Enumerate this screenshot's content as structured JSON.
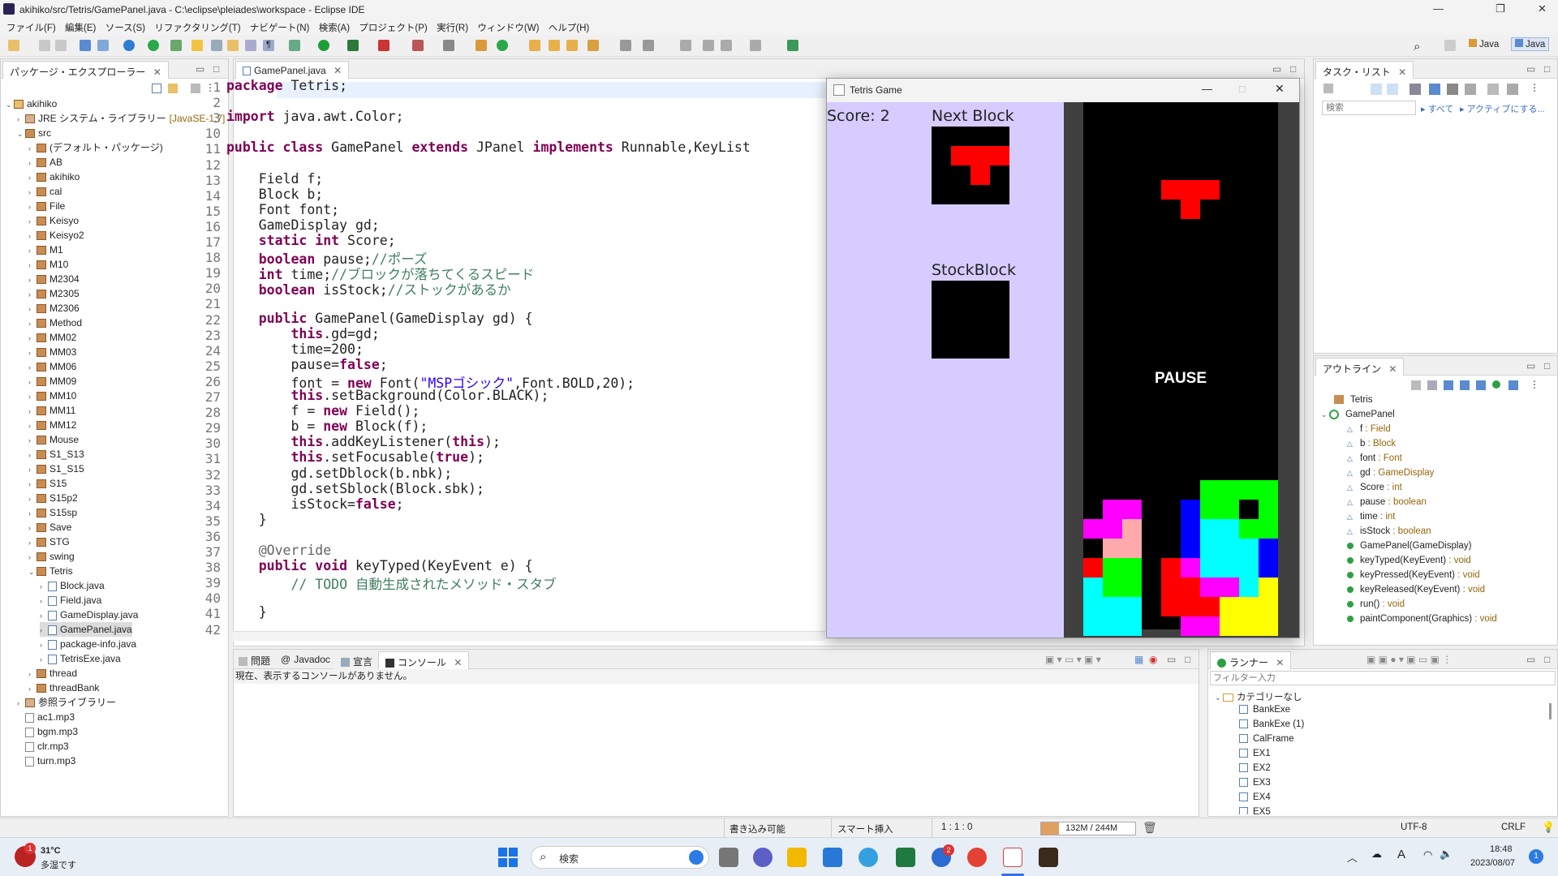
{
  "window": {
    "title": "akihiko/src/Tetris/GamePanel.java - C:\\eclipse\\pleiades\\workspace - Eclipse IDE"
  },
  "menu": [
    "ファイル(F)",
    "編集(E)",
    "ソース(S)",
    "リファクタリング(T)",
    "ナビゲート(N)",
    "検索(A)",
    "プロジェクト(P)",
    "実行(R)",
    "ウィンドウ(W)",
    "ヘルプ(H)"
  ],
  "perspectives": [
    "Java",
    "Java"
  ],
  "explorer": {
    "tab": "パッケージ・エクスプローラー",
    "items": [
      {
        "label": "akihiko",
        "level": 0,
        "kind": "project",
        "expanded": true
      },
      {
        "label": "JRE システム・ライブラリー",
        "extra": "[JavaSE-1.7]",
        "level": 1,
        "kind": "lib"
      },
      {
        "label": "src",
        "level": 1,
        "kind": "src",
        "expanded": true
      },
      {
        "label": "(デフォルト・パッケージ)",
        "level": 2,
        "kind": "pkg"
      },
      {
        "label": "AB",
        "level": 2,
        "kind": "pkg"
      },
      {
        "label": "akihiko",
        "level": 2,
        "kind": "pkg"
      },
      {
        "label": "cal",
        "level": 2,
        "kind": "pkg"
      },
      {
        "label": "File",
        "level": 2,
        "kind": "pkg"
      },
      {
        "label": "Keisyo",
        "level": 2,
        "kind": "pkg"
      },
      {
        "label": "Keisyo2",
        "level": 2,
        "kind": "pkg"
      },
      {
        "label": "M1",
        "level": 2,
        "kind": "pkg"
      },
      {
        "label": "M10",
        "level": 2,
        "kind": "pkg"
      },
      {
        "label": "M2304",
        "level": 2,
        "kind": "pkg"
      },
      {
        "label": "M2305",
        "level": 2,
        "kind": "pkg"
      },
      {
        "label": "M2306",
        "level": 2,
        "kind": "pkg"
      },
      {
        "label": "Method",
        "level": 2,
        "kind": "pkg"
      },
      {
        "label": "MM02",
        "level": 2,
        "kind": "pkg"
      },
      {
        "label": "MM03",
        "level": 2,
        "kind": "pkg"
      },
      {
        "label": "MM06",
        "level": 2,
        "kind": "pkg"
      },
      {
        "label": "MM09",
        "level": 2,
        "kind": "pkg"
      },
      {
        "label": "MM10",
        "level": 2,
        "kind": "pkg"
      },
      {
        "label": "MM11",
        "level": 2,
        "kind": "pkg"
      },
      {
        "label": "MM12",
        "level": 2,
        "kind": "pkg"
      },
      {
        "label": "Mouse",
        "level": 2,
        "kind": "pkg"
      },
      {
        "label": "S1_S13",
        "level": 2,
        "kind": "pkg"
      },
      {
        "label": "S1_S15",
        "level": 2,
        "kind": "pkg"
      },
      {
        "label": "S15",
        "level": 2,
        "kind": "pkg"
      },
      {
        "label": "S15p2",
        "level": 2,
        "kind": "pkg"
      },
      {
        "label": "S15sp",
        "level": 2,
        "kind": "pkg"
      },
      {
        "label": "Save",
        "level": 2,
        "kind": "pkg"
      },
      {
        "label": "STG",
        "level": 2,
        "kind": "pkg"
      },
      {
        "label": "swing",
        "level": 2,
        "kind": "pkg"
      },
      {
        "label": "Tetris",
        "level": 2,
        "kind": "pkg",
        "expanded": true
      },
      {
        "label": "Block.java",
        "level": 3,
        "kind": "java"
      },
      {
        "label": "Field.java",
        "level": 3,
        "kind": "java"
      },
      {
        "label": "GameDisplay.java",
        "level": 3,
        "kind": "java"
      },
      {
        "label": "GamePanel.java",
        "level": 3,
        "kind": "java",
        "selected": true
      },
      {
        "label": "package-info.java",
        "level": 3,
        "kind": "java"
      },
      {
        "label": "TetrisExe.java",
        "level": 3,
        "kind": "java"
      },
      {
        "label": "thread",
        "level": 2,
        "kind": "pkg"
      },
      {
        "label": "threadBank",
        "level": 2,
        "kind": "pkg"
      },
      {
        "label": "参照ライブラリー",
        "level": 1,
        "kind": "lib"
      },
      {
        "label": "ac1.mp3",
        "level": 1,
        "kind": "mp3"
      },
      {
        "label": "bgm.mp3",
        "level": 1,
        "kind": "mp3"
      },
      {
        "label": "clr.mp3",
        "level": 1,
        "kind": "mp3"
      },
      {
        "label": "turn.mp3",
        "level": 1,
        "kind": "mp3"
      }
    ]
  },
  "editor": {
    "tab": "GamePanel.java",
    "lines": [
      {
        "n": "1",
        "html": "<span class='kw'>package</span> Tetris;"
      },
      {
        "n": "2",
        "html": ""
      },
      {
        "n": "3",
        "html": "<span class='kw'>import</span> java.awt.Color;"
      },
      {
        "n": "10",
        "html": ""
      },
      {
        "n": "11",
        "html": "<span class='kw'>public class</span> GamePanel <span class='kw'>extends</span> JPanel <span class='kw'>implements</span> Runnable,KeyList"
      },
      {
        "n": "12",
        "html": ""
      },
      {
        "n": "13",
        "html": "    Field f;"
      },
      {
        "n": "14",
        "html": "    Block b;"
      },
      {
        "n": "15",
        "html": "    Font font;"
      },
      {
        "n": "16",
        "html": "    GameDisplay gd;"
      },
      {
        "n": "17",
        "html": "    <span class='kw'>static int</span> Score;"
      },
      {
        "n": "18",
        "html": "    <span class='kw'>boolean</span> pause;<span class='cm'>//ポーズ</span>"
      },
      {
        "n": "19",
        "html": "    <span class='kw'>int</span> time;<span class='cm'>//ブロックが落ちてくるスピード</span>"
      },
      {
        "n": "20",
        "html": "    <span class='kw'>boolean</span> isStock;<span class='cm'>//ストックがあるか</span>"
      },
      {
        "n": "21",
        "html": ""
      },
      {
        "n": "22",
        "html": "    <span class='kw'>public</span> GamePanel(GameDisplay gd) {"
      },
      {
        "n": "23",
        "html": "        <span class='kw'>this</span>.gd=gd;"
      },
      {
        "n": "24",
        "html": "        time=200;"
      },
      {
        "n": "25",
        "html": "        pause=<span class='kw'>false</span>;"
      },
      {
        "n": "26",
        "html": "        font = <span class='kw'>new</span> Font(<span class='str'>\"MSPゴシック\"</span>,Font.BOLD,20);"
      },
      {
        "n": "27",
        "html": "        <span class='kw'>this</span>.setBackground(Color.BLACK);"
      },
      {
        "n": "28",
        "html": "        f = <span class='kw'>new</span> Field();"
      },
      {
        "n": "29",
        "html": "        b = <span class='kw'>new</span> Block(f);"
      },
      {
        "n": "30",
        "html": "        <span class='kw'>this</span>.addKeyListener(<span class='kw'>this</span>);"
      },
      {
        "n": "31",
        "html": "        <span class='kw'>this</span>.setFocusable(<span class='kw'>true</span>);"
      },
      {
        "n": "32",
        "html": "        gd.setDblock(b.nbk);"
      },
      {
        "n": "33",
        "html": "        gd.setSblock(Block.sbk);"
      },
      {
        "n": "34",
        "html": "        isStock=<span class='kw'>false</span>;"
      },
      {
        "n": "35",
        "html": "    }"
      },
      {
        "n": "36",
        "html": ""
      },
      {
        "n": "37",
        "html": "    <span class='ann'>@Override</span>"
      },
      {
        "n": "38",
        "html": "    <span class='kw'>public void</span> keyTyped(KeyEvent e) {"
      },
      {
        "n": "39",
        "html": "        <span class='cm'>// TODO 自動生成されたメソッド・スタブ</span>"
      },
      {
        "n": "40",
        "html": ""
      },
      {
        "n": "41",
        "html": "    }"
      },
      {
        "n": "42",
        "html": ""
      }
    ]
  },
  "tasklist": {
    "tab": "タスク・リスト",
    "search_placeholder": "検索",
    "all": "すべて",
    "activate": "アクティブにする..."
  },
  "outline": {
    "tab": "アウトライン",
    "root": "Tetris",
    "class": "GamePanel",
    "members": [
      {
        "kind": "field",
        "name": "f",
        "type": "Field"
      },
      {
        "kind": "field",
        "name": "b",
        "type": "Block"
      },
      {
        "kind": "field",
        "name": "font",
        "type": "Font"
      },
      {
        "kind": "field",
        "name": "gd",
        "type": "GameDisplay"
      },
      {
        "kind": "field",
        "name": "Score",
        "type": "int",
        "static": true
      },
      {
        "kind": "field",
        "name": "pause",
        "type": "boolean"
      },
      {
        "kind": "field",
        "name": "time",
        "type": "int"
      },
      {
        "kind": "field",
        "name": "isStock",
        "type": "boolean"
      },
      {
        "kind": "method",
        "name": "GamePanel(GameDisplay)",
        "type": ""
      },
      {
        "kind": "method",
        "name": "keyTyped(KeyEvent)",
        "type": "void"
      },
      {
        "kind": "method",
        "name": "keyPressed(KeyEvent)",
        "type": "void"
      },
      {
        "kind": "method",
        "name": "keyReleased(KeyEvent)",
        "type": "void"
      },
      {
        "kind": "method",
        "name": "run()",
        "type": "void"
      },
      {
        "kind": "method",
        "name": "paintComponent(Graphics)",
        "type": "void"
      }
    ]
  },
  "bottom": {
    "tabs": [
      "問題",
      "Javadoc",
      "宣言",
      "コンソール"
    ],
    "console_msg": "現在、表示するコンソールがありません。"
  },
  "runner": {
    "tab": "ランナー",
    "filter_placeholder": "フィルター入力",
    "category": "カテゴリーなし",
    "items": [
      "BankExe",
      "BankExe (1)",
      "CalFrame",
      "EX1",
      "EX2",
      "EX3",
      "EX4",
      "EX5"
    ]
  },
  "statusbar": {
    "writable": "書き込み可能",
    "insert": "スマート挿入",
    "pos": "1 : 1 : 0",
    "memory": "132M / 244M",
    "encoding": "UTF-8",
    "eol": "CRLF"
  },
  "tetris": {
    "title": "Tetris Game",
    "score": "Score: 2",
    "next": "Next Block",
    "stock": "StockBlock",
    "pause": "PAUSE"
  },
  "taskbar": {
    "weather_temp": "31°C",
    "weather_desc": "多湿です",
    "weather_badge": "1",
    "search": "検索",
    "time": "18:48",
    "date": "2023/08/07",
    "notif": "1",
    "mail_badge": "2"
  },
  "colors": {
    "red": "#ff0000",
    "green": "#00ff00",
    "cyan": "#00ffff",
    "magenta": "#ff00ff",
    "blue": "#0000ff",
    "pink": "#ffaaaa",
    "yellow": "#ffff00",
    "lavender": "#d6ccff",
    "black": "#000000",
    "gray": "#404040"
  }
}
